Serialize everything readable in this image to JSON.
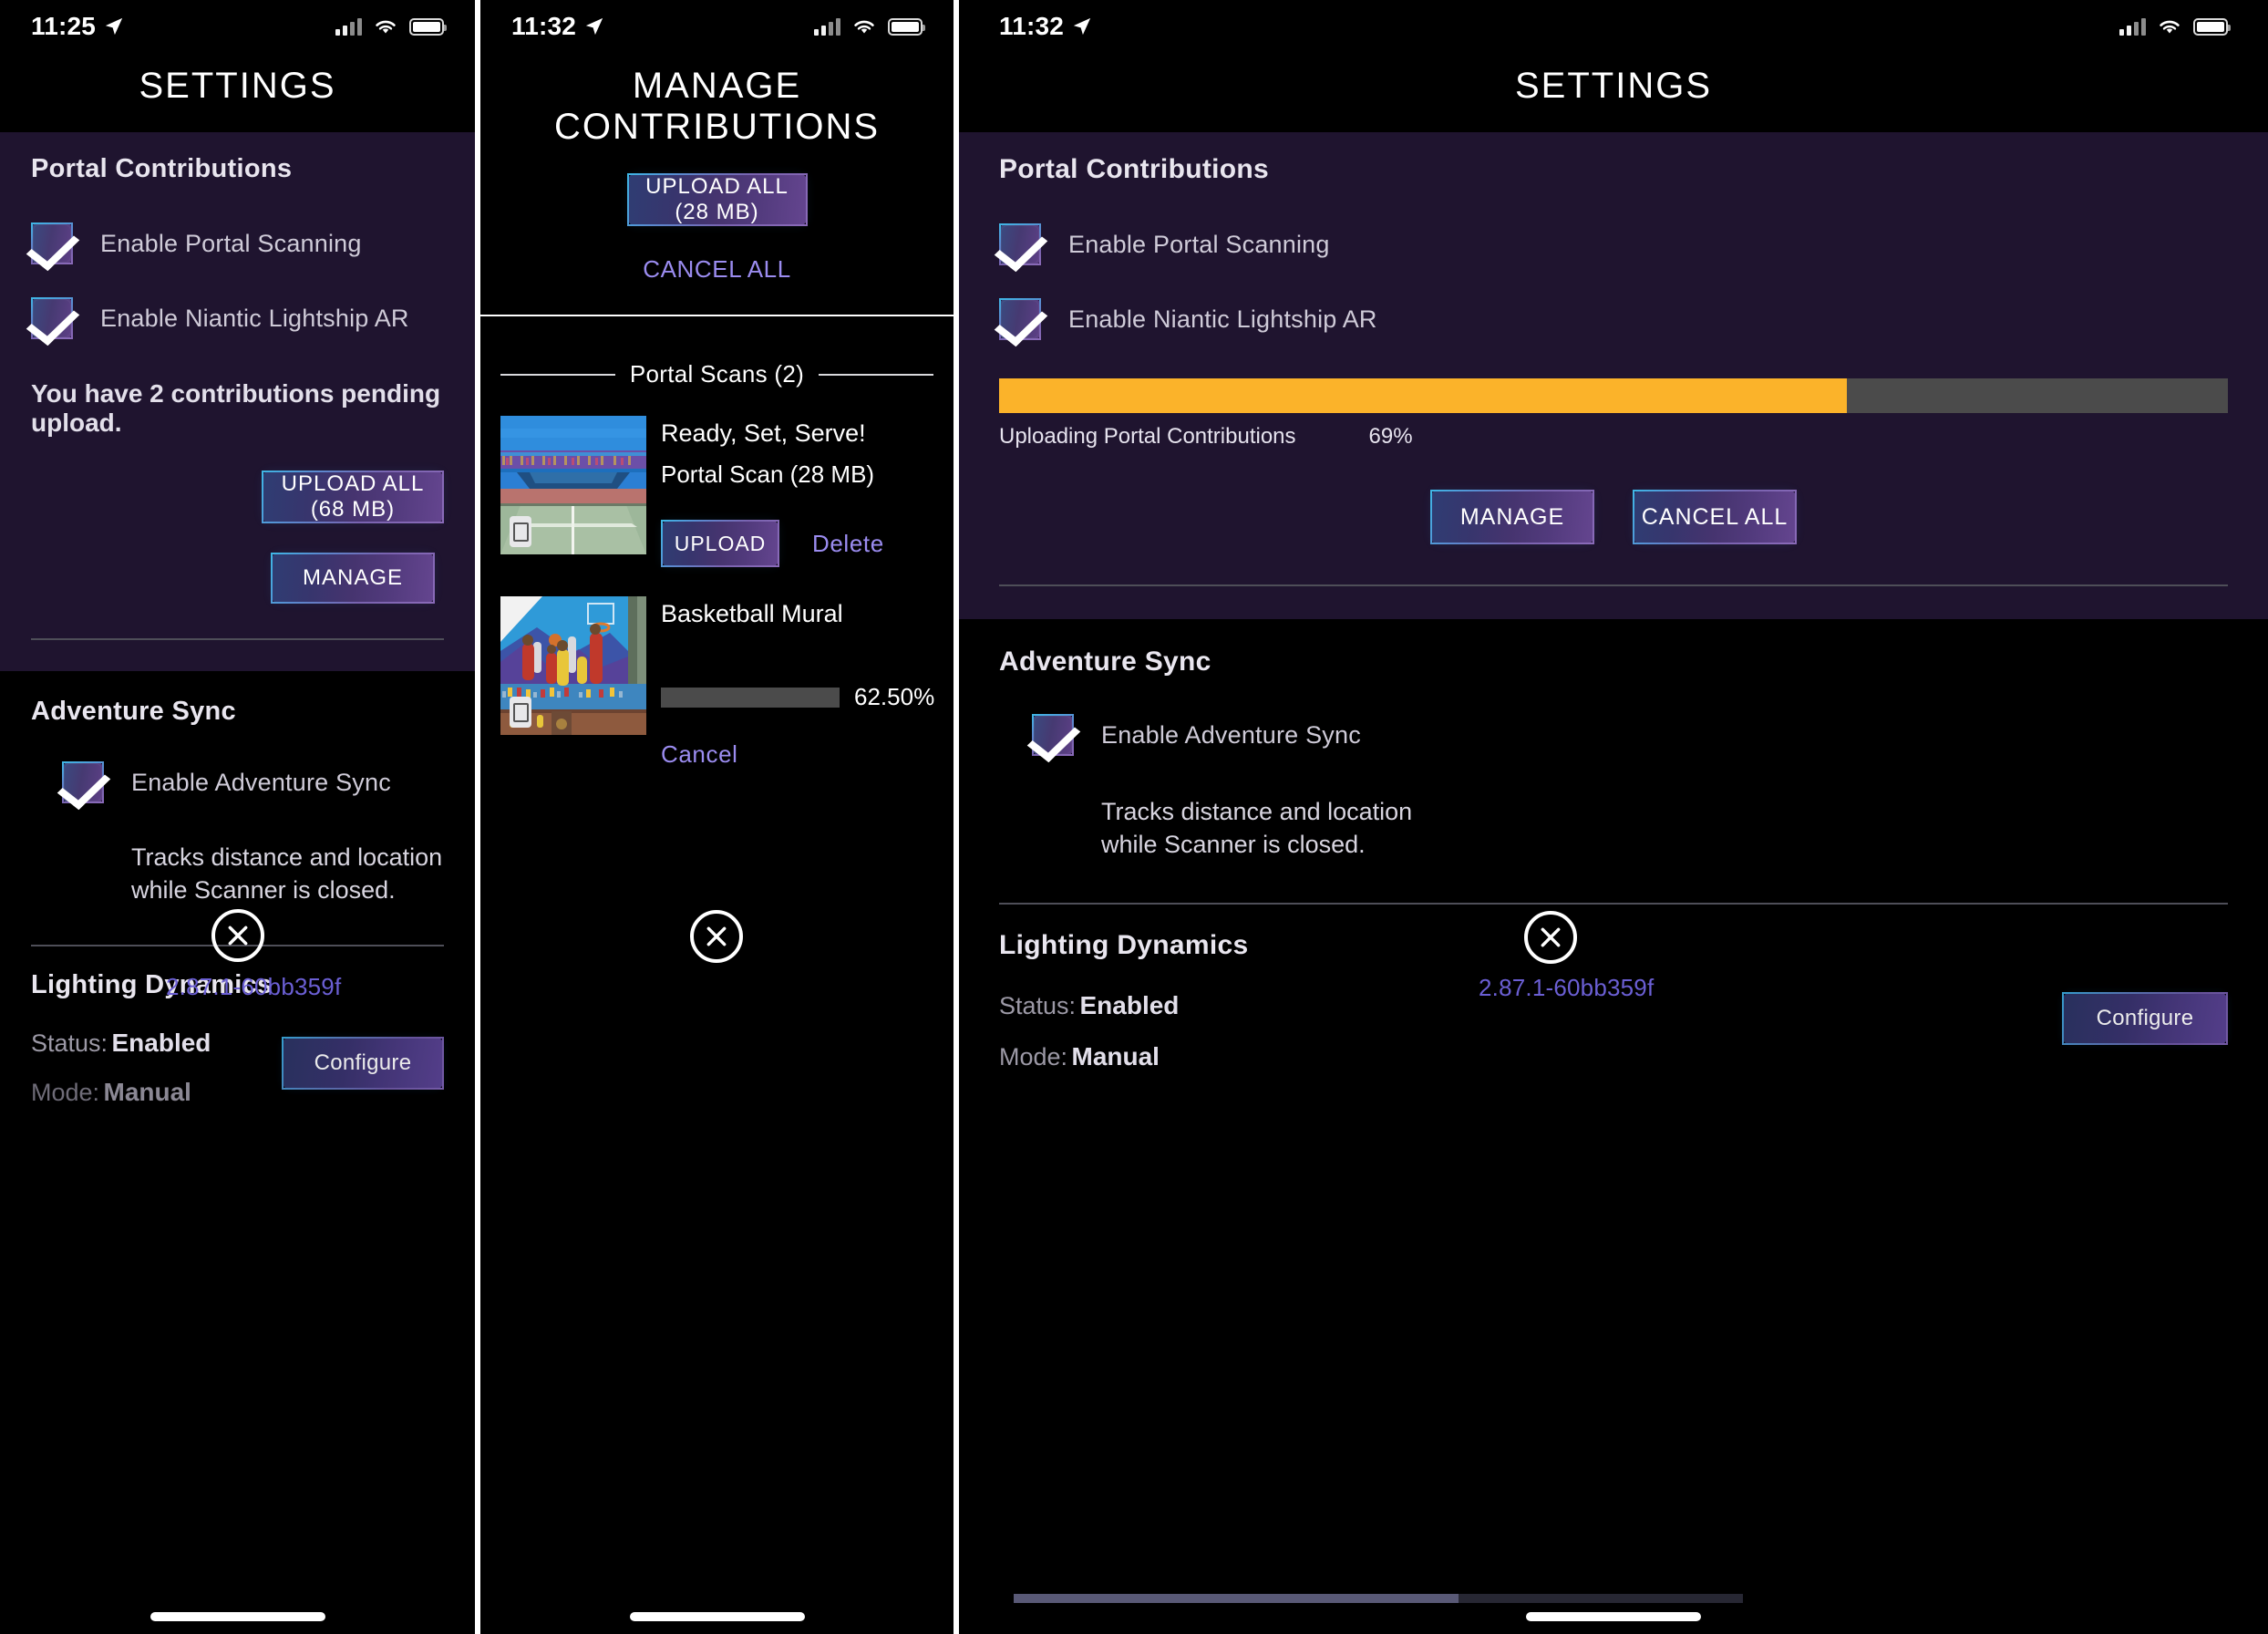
{
  "panels": [
    {
      "id": "settings-before",
      "statusbar": {
        "time": "11:25",
        "location_icon": "location-arrow-icon",
        "signal_icon": "cellular-signal-icon",
        "wifi_icon": "wifi-icon",
        "battery_icon": "battery-icon"
      },
      "title": "SETTINGS",
      "portal": {
        "heading": "Portal Contributions",
        "checkboxes": [
          {
            "label": "Enable Portal Scanning",
            "checked": true
          },
          {
            "label": "Enable Niantic Lightship AR",
            "checked": true
          }
        ],
        "pending_text": "You have 2 contributions pending upload.",
        "upload_all_label": "UPLOAD ALL (68 MB)",
        "manage_label": "MANAGE"
      },
      "adventure": {
        "heading": "Adventure Sync",
        "checkbox": {
          "label": "Enable Adventure Sync",
          "checked": true
        },
        "description": "Tracks distance and location while Scanner is closed."
      },
      "lighting": {
        "heading": "Lighting Dynamics",
        "status_label": "Status:",
        "status_value": "Enabled",
        "mode_label": "Mode:",
        "mode_value": "Manual",
        "configure_label": "Configure"
      },
      "version": "2.87.1-60bb359f",
      "close_icon": "close-x-icon"
    },
    {
      "id": "manage-contributions",
      "statusbar": {
        "time": "11:32",
        "location_icon": "location-arrow-icon",
        "signal_icon": "cellular-signal-icon",
        "wifi_icon": "wifi-icon",
        "battery_icon": "battery-icon"
      },
      "title": "MANAGE CONTRIBUTIONS",
      "upload_all_label": "UPLOAD ALL (28 MB)",
      "cancel_all_label": "CANCEL ALL",
      "list_heading": "Portal Scans (2)",
      "scans": [
        {
          "title": "Ready, Set, Serve!",
          "subtitle": "Portal Scan  (28 MB)",
          "thumbnail": "tennis-court-thumbnail",
          "state": "pending",
          "upload_label": "UPLOAD",
          "delete_label": "Delete"
        },
        {
          "title": "Basketball Mural",
          "thumbnail": "basketball-mural-thumbnail",
          "state": "uploading",
          "progress_pct": 62.5,
          "progress_text": "62.50%",
          "cancel_label": "Cancel"
        }
      ],
      "close_icon": "close-x-icon"
    },
    {
      "id": "settings-uploading",
      "statusbar": {
        "time": "11:32",
        "location_icon": "location-arrow-icon",
        "signal_icon": "cellular-signal-icon",
        "wifi_icon": "wifi-icon",
        "battery_icon": "battery-icon"
      },
      "title": "SETTINGS",
      "portal": {
        "heading": "Portal Contributions",
        "checkboxes": [
          {
            "label": "Enable Portal Scanning",
            "checked": true
          },
          {
            "label": "Enable Niantic Lightship AR",
            "checked": true
          }
        ],
        "progress": {
          "label": "Uploading Portal Contributions",
          "pct_text": "69%",
          "pct": 69
        },
        "manage_label": "MANAGE",
        "cancel_all_label": "CANCEL ALL"
      },
      "adventure": {
        "heading": "Adventure Sync",
        "checkbox": {
          "label": "Enable Adventure Sync",
          "checked": true
        },
        "description": "Tracks distance and location while Scanner is closed."
      },
      "lighting": {
        "heading": "Lighting Dynamics",
        "status_label": "Status:",
        "status_value": "Enabled",
        "mode_label": "Mode:",
        "mode_value": "Manual",
        "configure_label": "Configure"
      },
      "version": "2.87.1-60bb359f",
      "close_icon": "close-x-icon"
    }
  ],
  "colors": {
    "panel_purple": "#1f142f",
    "progress_orange": "#fbb32a",
    "progress_track": "#4b4b4b",
    "link_purple": "#9b8cf0",
    "version_purple": "#6b5fd4",
    "accent_cyan": "#3fb6e6"
  }
}
